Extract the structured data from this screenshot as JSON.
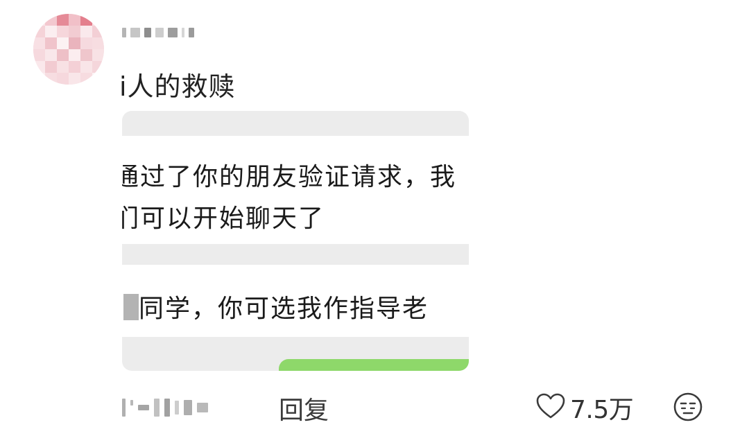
{
  "comment": {
    "text": "i人的救赎",
    "reply_label": "回复",
    "like_count": "7.5万",
    "icons": {
      "like": "heart-outline-icon",
      "dislike": "unamused-face-icon"
    }
  },
  "screenshot": {
    "line1": "通过了你的朋友验证请求，我",
    "line2": "们可以开始聊天了",
    "line3": "同学，你可选我作指导老",
    "accent_green": "#8ED86A",
    "band_gray": "#ECECEC"
  }
}
